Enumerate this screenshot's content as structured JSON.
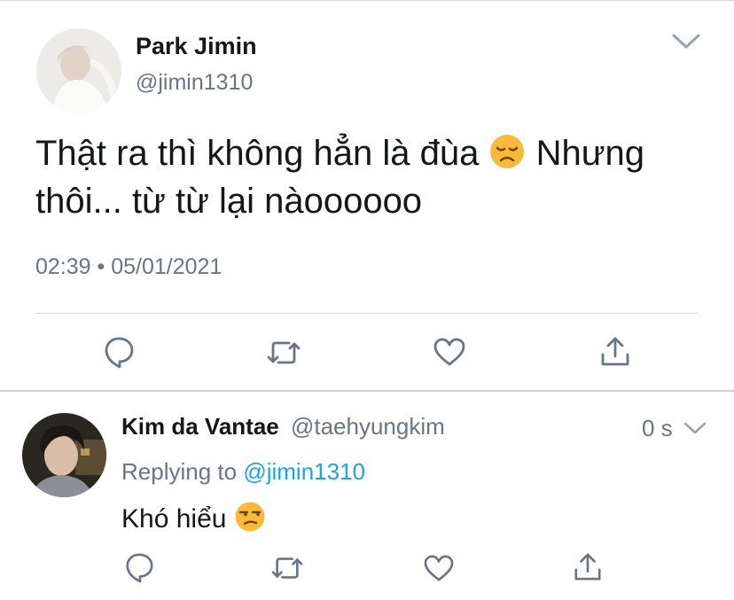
{
  "tweet": {
    "author_name": "Park Jimin",
    "author_handle": "@jimin1310",
    "text": "Thật ra thì không hẳn là đùa",
    "emoji": "disappointed-face",
    "text_after_emoji": " Nhưng thôi... từ từ lại nàoooooo",
    "time": "02:39",
    "separator": "•",
    "date": "05/01/2021",
    "actions": [
      "reply-icon",
      "retweet-icon",
      "like-icon",
      "share-icon"
    ]
  },
  "reply": {
    "author_name": "Kim da Vantae",
    "author_handle": "@taehyungkim",
    "time": "0 s",
    "replying_to_label": "Replying to",
    "replying_to_handle": "@jimin1310",
    "text": "Khó hiểu",
    "emoji": "unamused-face",
    "actions": [
      "reply-icon",
      "retweet-icon",
      "like-icon",
      "share-icon"
    ]
  },
  "colors": {
    "text_primary": "#14171a",
    "text_secondary": "#657786",
    "link": "#1da1f2",
    "divider": "#d6d9dc"
  }
}
